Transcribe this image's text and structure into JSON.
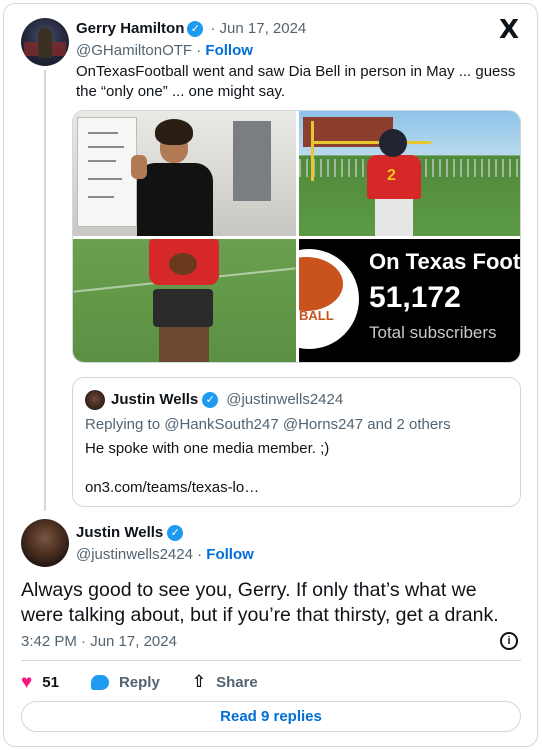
{
  "parent_tweet": {
    "name": "Gerry Hamilton",
    "date": "· Jun 17, 2024",
    "handle": "@GHamiltonOTF",
    "follow": "Follow",
    "text": "OnTexasFootball went and saw Dia Bell in person in May ... guess the “only one” ... one might say.",
    "media": {
      "subscriber_card": {
        "title": "On Texas Foot",
        "count": "51,172",
        "label": "Total subscribers",
        "logo_text": "XAS\nBALL"
      },
      "jersey_number": "2"
    },
    "quoted": {
      "name": "Justin Wells",
      "handle": "@justinwells2424",
      "replying": "Replying to @HankSouth247 @Horns247 and 2 others",
      "text": "He spoke with one media member. ;)",
      "link": "on3.com/teams/texas-lo…"
    }
  },
  "main_tweet": {
    "name": "Justin Wells",
    "handle": "@justinwells2424",
    "follow": "Follow",
    "text": "Always good to see you, Gerry. If only that’s what we were talking about, but if you’re that thirsty, get a drank.",
    "timestamp": "3:42 PM · Jun 17, 2024",
    "likes": "51",
    "reply_label": "Reply",
    "share_label": "Share",
    "read_replies": "Read 9 replies"
  },
  "icons": {
    "x_logo": "X",
    "verified": "✓",
    "info": "i",
    "heart": "♥",
    "share": "⇧"
  },
  "colors": {
    "accent_blue": "#1d9bf0",
    "link_blue": "#006fd6",
    "like_pink": "#f91880",
    "muted_text": "#536471",
    "border": "#cfd9de"
  }
}
